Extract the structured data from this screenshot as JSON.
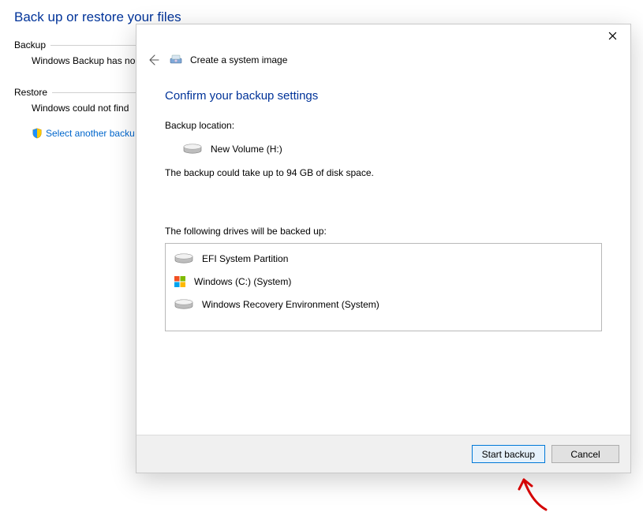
{
  "background": {
    "title": "Back up or restore your files",
    "backup_section_label": "Backup",
    "backup_text": "Windows Backup has no",
    "restore_section_label": "Restore",
    "restore_text": "Windows could not find",
    "restore_link": "Select another backu"
  },
  "dialog": {
    "header_title": "Create a system image",
    "heading": "Confirm your backup settings",
    "location_label": "Backup location:",
    "location_value": "New Volume (H:)",
    "size_text": "The backup could take up to 94 GB of disk space.",
    "drives_label": "The following drives will be backed up:",
    "drives": [
      {
        "icon": "disk",
        "name": "EFI System Partition"
      },
      {
        "icon": "windows",
        "name": "Windows (C:) (System)"
      },
      {
        "icon": "disk",
        "name": "Windows Recovery Environment (System)"
      }
    ],
    "start_button": "Start backup",
    "cancel_button": "Cancel"
  }
}
